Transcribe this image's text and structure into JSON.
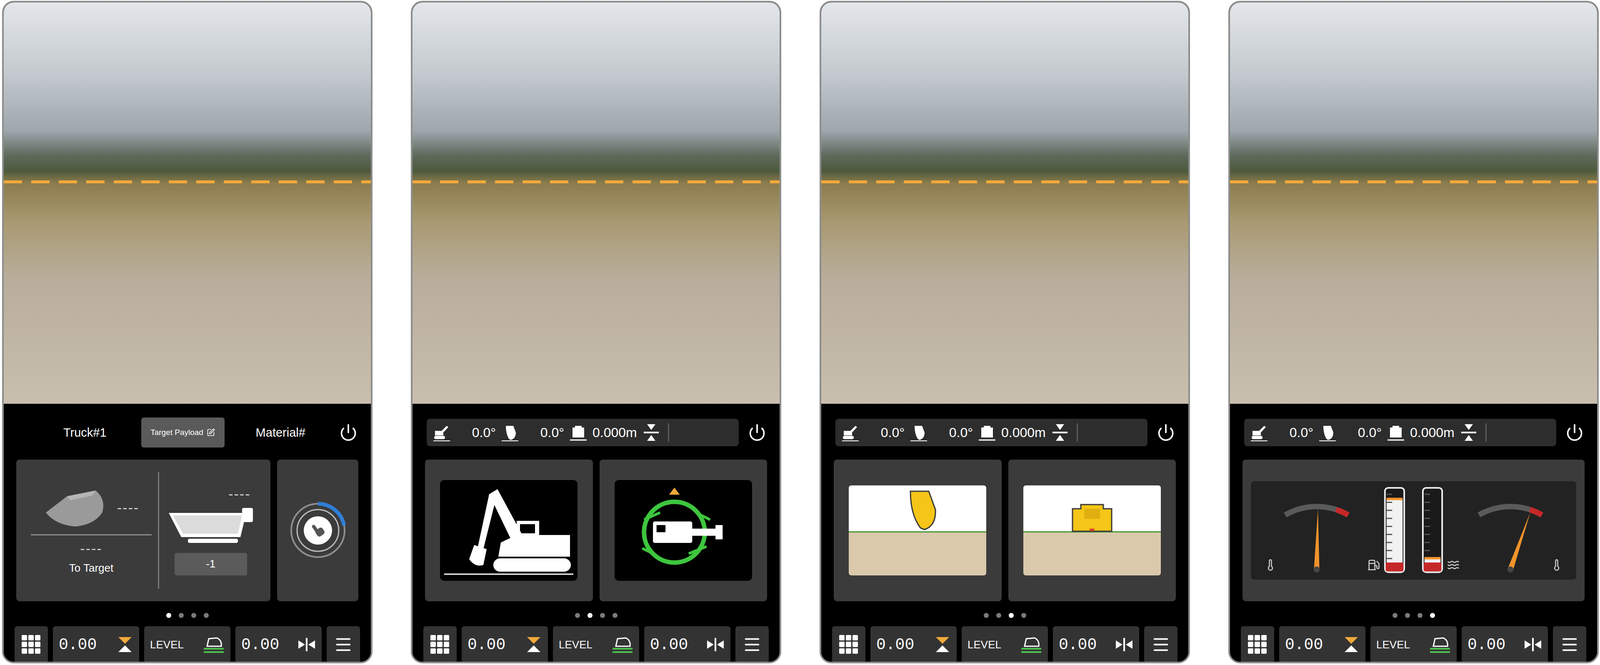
{
  "screens": [
    {
      "kind": "payload",
      "header": {
        "truck": "Truck#1",
        "target_button": "Target Payload",
        "material": "Material#"
      },
      "payload": {
        "bucket_value": "----",
        "to_target_value": "----",
        "to_target_label": "To Target",
        "truck_value": "----",
        "truck_count": "-1",
        "progress_level": 0.22
      },
      "page_dots": [
        {
          "selected": true
        },
        {
          "selected": false
        },
        {
          "selected": false
        },
        {
          "selected": false
        }
      ],
      "bottom_bar": {
        "elevation_value": "0.00",
        "mode": "LEVEL",
        "offset_value": "0.00"
      }
    },
    {
      "kind": "machine",
      "readings": [
        {
          "value": "0.0°"
        },
        {
          "value": "0.0°"
        },
        {
          "value": "0.000m"
        }
      ],
      "page_dots": [
        {
          "selected": false
        },
        {
          "selected": true
        },
        {
          "selected": false
        },
        {
          "selected": false
        }
      ],
      "bottom_bar": {
        "elevation_value": "0.00",
        "mode": "LEVEL",
        "offset_value": "0.00"
      }
    },
    {
      "kind": "bucket",
      "readings": [
        {
          "value": "0.0°"
        },
        {
          "value": "0.0°"
        },
        {
          "value": "0.000m"
        }
      ],
      "page_dots": [
        {
          "selected": false
        },
        {
          "selected": false
        },
        {
          "selected": true
        },
        {
          "selected": false
        }
      ],
      "bottom_bar": {
        "elevation_value": "0.00",
        "mode": "LEVEL",
        "offset_value": "0.00"
      }
    },
    {
      "kind": "gauges",
      "readings": [
        {
          "value": "0.0°"
        },
        {
          "value": "0.0°"
        },
        {
          "value": "0.000m"
        }
      ],
      "gauges": [
        {
          "kind": "dial",
          "level": 0.52
        },
        {
          "kind": "bar",
          "level": 0.88
        },
        {
          "kind": "bar",
          "level": 0.06
        },
        {
          "kind": "dial",
          "level": 0.82
        }
      ],
      "page_dots": [
        {
          "selected": false
        },
        {
          "selected": false
        },
        {
          "selected": false
        },
        {
          "selected": true
        }
      ],
      "bottom_bar": {
        "elevation_value": "0.00",
        "mode": "LEVEL",
        "offset_value": "0.00"
      }
    }
  ]
}
